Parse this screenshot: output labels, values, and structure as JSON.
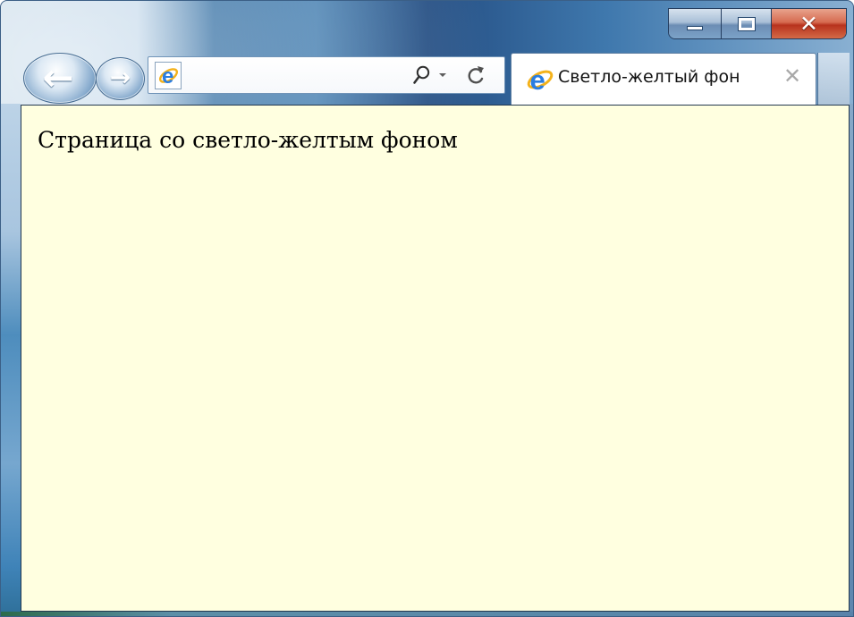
{
  "colors": {
    "page_background": "#ffffe0",
    "window_frame": "#2f6497",
    "close_button": "#c94b32",
    "ie_blue": "#2a7de1",
    "ie_orange": "#f4b21b"
  },
  "window": {
    "buttons": {
      "minimize_icon": "minimize-icon",
      "maximize_icon": "maximize-icon",
      "close_label": "✕"
    }
  },
  "navigation": {
    "back_glyph": "←",
    "forward_glyph": "→"
  },
  "address_bar": {
    "value": "",
    "search_icon": "search-icon",
    "dropdown_icon": "chevron-down-icon",
    "refresh_icon": "refresh-icon"
  },
  "tabs": [
    {
      "title": "Светло-желтый фон",
      "icon": "internet-explorer-icon",
      "close_label": "✕"
    }
  ],
  "page": {
    "text": "Страница со светло-желтым фоном"
  }
}
